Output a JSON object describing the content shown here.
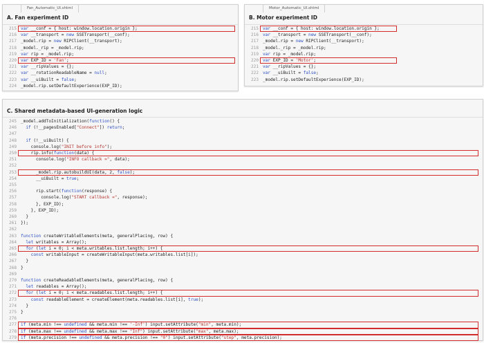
{
  "panel_a": {
    "tab": "Fan_Automatic_UI.shtml",
    "title": "A. Fan experiment ID",
    "lines": [
      {
        "n": "215",
        "t": "var __conf = { host: window.location.origin };",
        "h": true
      },
      {
        "n": "216",
        "t": "var __transport = new SSETransport(__conf);"
      },
      {
        "n": "217",
        "t": "_model.rip = new RIPClient(__transport);"
      },
      {
        "n": "218",
        "t": "_model._rip = _model.rip;"
      },
      {
        "n": "219",
        "t": "var rip = _model.rip;"
      },
      {
        "n": "220",
        "t": "var EXP_ID = 'Fan';",
        "h": true
      },
      {
        "n": "221",
        "t": "var __ripValues = {};"
      },
      {
        "n": "222",
        "t": "var __rotationReadableName = null;"
      },
      {
        "n": "223",
        "t": "var __uiBuilt = false;"
      },
      {
        "n": "224",
        "t": "_model.rip.setDefaultExperience(EXP_ID);"
      }
    ]
  },
  "panel_b": {
    "tab": "Motor_Automatic_UI.shtml",
    "title": "B. Motor experiment ID",
    "lines": [
      {
        "n": "215",
        "t": "var __conf = { host: window.location.origin };",
        "h": true
      },
      {
        "n": "216",
        "t": "var __transport = new SSETransport(__conf);"
      },
      {
        "n": "217",
        "t": "_model.rip = new RIPClient(__transport);"
      },
      {
        "n": "218",
        "t": "_model._rip = _model.rip;"
      },
      {
        "n": "219",
        "t": "var rip = _model.rip;"
      },
      {
        "n": "220",
        "t": "var EXP_ID = 'Motor';",
        "h": true
      },
      {
        "n": "221",
        "t": "var __ripValues = {};"
      },
      {
        "n": "222",
        "t": "var __uiBuilt = false;"
      },
      {
        "n": "223",
        "t": "_model.rip.setDefaultExperience(EXP_ID);"
      }
    ]
  },
  "panel_c": {
    "title": "C. Shared metadata-based UI-generation logic",
    "lines": [
      {
        "n": "245",
        "t": "_model.addToInitialization(function() {"
      },
      {
        "n": "246",
        "t": "  if (!__pagesEnabled[\"Connect\"]) return;"
      },
      {
        "n": "247",
        "t": ""
      },
      {
        "n": "248",
        "t": "  if (!__uiBuilt) {"
      },
      {
        "n": "249",
        "t": "    console.log(\"INIT before info\");"
      },
      {
        "n": "250",
        "t": "    rip.info(function(data) {",
        "h": true
      },
      {
        "n": "251",
        "t": "      console.log(\"INFO callback =\", data);"
      },
      {
        "n": "252",
        "t": ""
      },
      {
        "n": "253",
        "t": "      _model.rip.autobuildUI(data, 2, false);",
        "h": true
      },
      {
        "n": "254",
        "t": "      __uiBuilt = true;"
      },
      {
        "n": "255",
        "t": ""
      },
      {
        "n": "256",
        "t": "      rip.start(function(response) {"
      },
      {
        "n": "257",
        "t": "        console.log(\"START callback =\", response);"
      },
      {
        "n": "258",
        "t": "      }, EXP_ID);"
      },
      {
        "n": "259",
        "t": "    }, EXP_ID);"
      },
      {
        "n": "260",
        "t": "  }"
      },
      {
        "n": "261",
        "t": "});"
      },
      {
        "n": "262",
        "t": ""
      },
      {
        "n": "263",
        "t": "function createWritableElements(meta, generalPlacing, row) {"
      },
      {
        "n": "264",
        "t": "  let writables = Array();"
      },
      {
        "n": "265",
        "t": "  for (let i = 0; i < meta.writables.list.length; i++) {",
        "h": true
      },
      {
        "n": "266",
        "t": "    const writableInput = createWritableInput(meta.writables.list[i]);"
      },
      {
        "n": "267",
        "t": "  }"
      },
      {
        "n": "268",
        "t": "}"
      },
      {
        "n": "269",
        "t": ""
      },
      {
        "n": "270",
        "t": "function createReadableElements(meta, generalPlacing, row) {"
      },
      {
        "n": "271",
        "t": "  let readables = Array();"
      },
      {
        "n": "272",
        "t": "  for (let i = 0; i < meta.readables.list.length; i++) {",
        "h": true
      },
      {
        "n": "273",
        "t": "    const readableElement = createElement(meta.readables.list[i], true);"
      },
      {
        "n": "274",
        "t": "  }"
      },
      {
        "n": "275",
        "t": "}"
      },
      {
        "n": "276",
        "t": ""
      },
      {
        "n": "277",
        "t": "if (meta.min !== undefined && meta.min !== '-Inf') input.setAttribute(\"min\", meta.min);",
        "h": true
      },
      {
        "n": "278",
        "t": "if (meta.max !== undefined && meta.max !== \"Inf\") input.setAttribute(\"max\", meta.max);",
        "h": true
      },
      {
        "n": "279",
        "t": "if (meta.precision !== undefined && meta.precision !== \"0\") input.setAttribute(\"step\", meta.precision);",
        "h": true
      }
    ]
  },
  "colors": {
    "highlight_border": "#d12b2b",
    "keyword": "#2b4fc2",
    "string": "#b3322b",
    "line_number": "#9a9a9a"
  }
}
